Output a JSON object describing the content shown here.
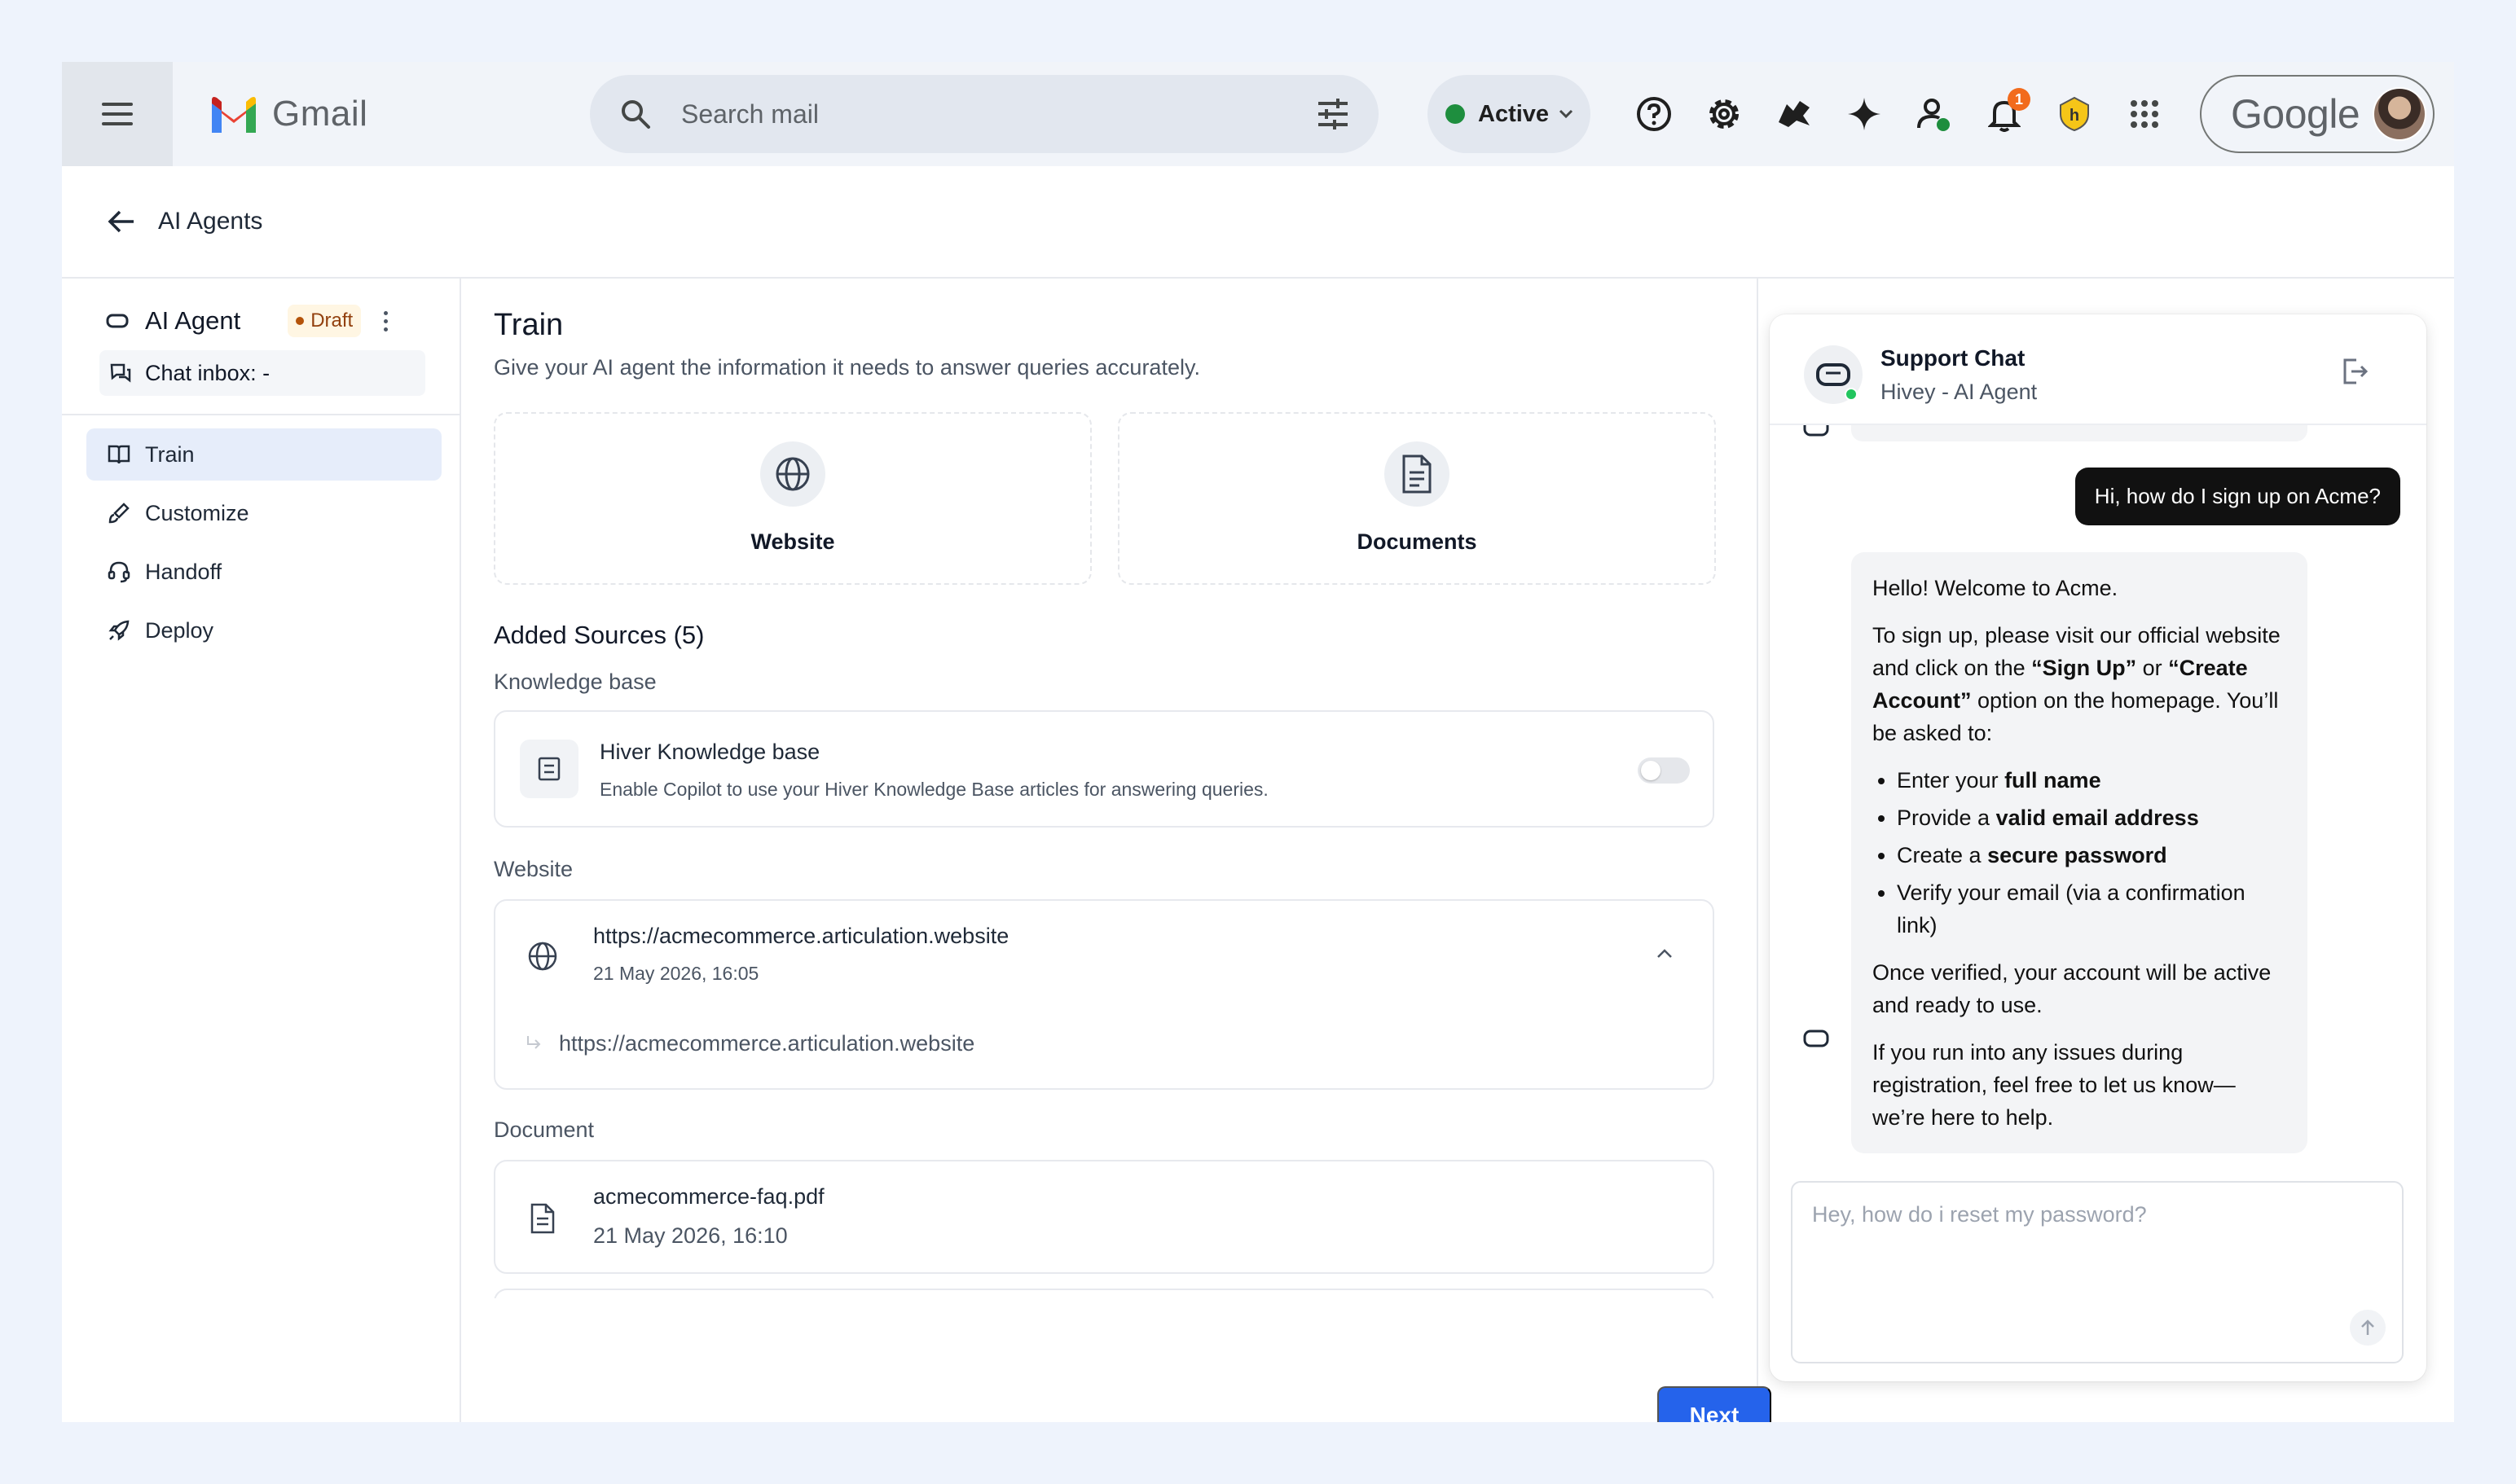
{
  "gmail": {
    "app_name": "Gmail",
    "search_placeholder": "Search mail",
    "status": "Active",
    "notification_count": "1",
    "account_label": "Google"
  },
  "page": {
    "back_title": "AI Agents"
  },
  "sidebar": {
    "agent_name": "AI Agent",
    "agent_status": "Draft",
    "chat_inbox": "Chat inbox: -",
    "nav": [
      {
        "label": "Train",
        "icon": "book-icon",
        "active": true
      },
      {
        "label": "Customize",
        "icon": "brush-icon",
        "active": false
      },
      {
        "label": "Handoff",
        "icon": "headset-icon",
        "active": false
      },
      {
        "label": "Deploy",
        "icon": "rocket-icon",
        "active": false
      }
    ]
  },
  "train": {
    "title": "Train",
    "subtitle": "Give your AI agent the information it needs to answer queries accurately.",
    "source_options": [
      {
        "label": "Website",
        "icon": "globe-icon"
      },
      {
        "label": "Documents",
        "icon": "document-icon"
      }
    ],
    "added_sources": "Added Sources (5)",
    "knowledge_base": {
      "section": "Knowledge base",
      "title": "Hiver Knowledge base",
      "description": "Enable Copilot to use your Hiver Knowledge Base articles for answering queries.",
      "enabled": false
    },
    "website": {
      "section": "Website",
      "url": "https://acmecommerce.articulation.website",
      "date": "21 May 2026, 16:05",
      "child_url": "https://acmecommerce.articulation.website"
    },
    "document": {
      "section": "Document",
      "name": "acmecommerce-faq.pdf",
      "date": "21 May 2026, 16:10"
    },
    "next_label": "Next"
  },
  "chat": {
    "title": "Support Chat",
    "subtitle": "Hivey - AI Agent",
    "user_message": "Hi, how do I sign up on Acme?",
    "bot": {
      "greeting": "Hello! Welcome to Acme.",
      "p1_a": "To sign up, please visit our official website and click on the ",
      "p1_b": "“Sign Up”",
      "p1_c": " or ",
      "p1_d": "“Create Account”",
      "p1_e": " option on the homepage. You’ll be asked to:",
      "li1_a": "Enter your ",
      "li1_b": "full name",
      "li2_a": "Provide a ",
      "li2_b": "valid email address",
      "li3_a": "Create a ",
      "li3_b": "secure password",
      "li4": "Verify your email (via a confirmation link)",
      "p2": "Once verified, your account will be active and ready to use.",
      "p3": "If you run into any issues during registration, feel free to let us know—we’re here to help."
    },
    "input_placeholder": "Hey, how do i reset my password?"
  }
}
